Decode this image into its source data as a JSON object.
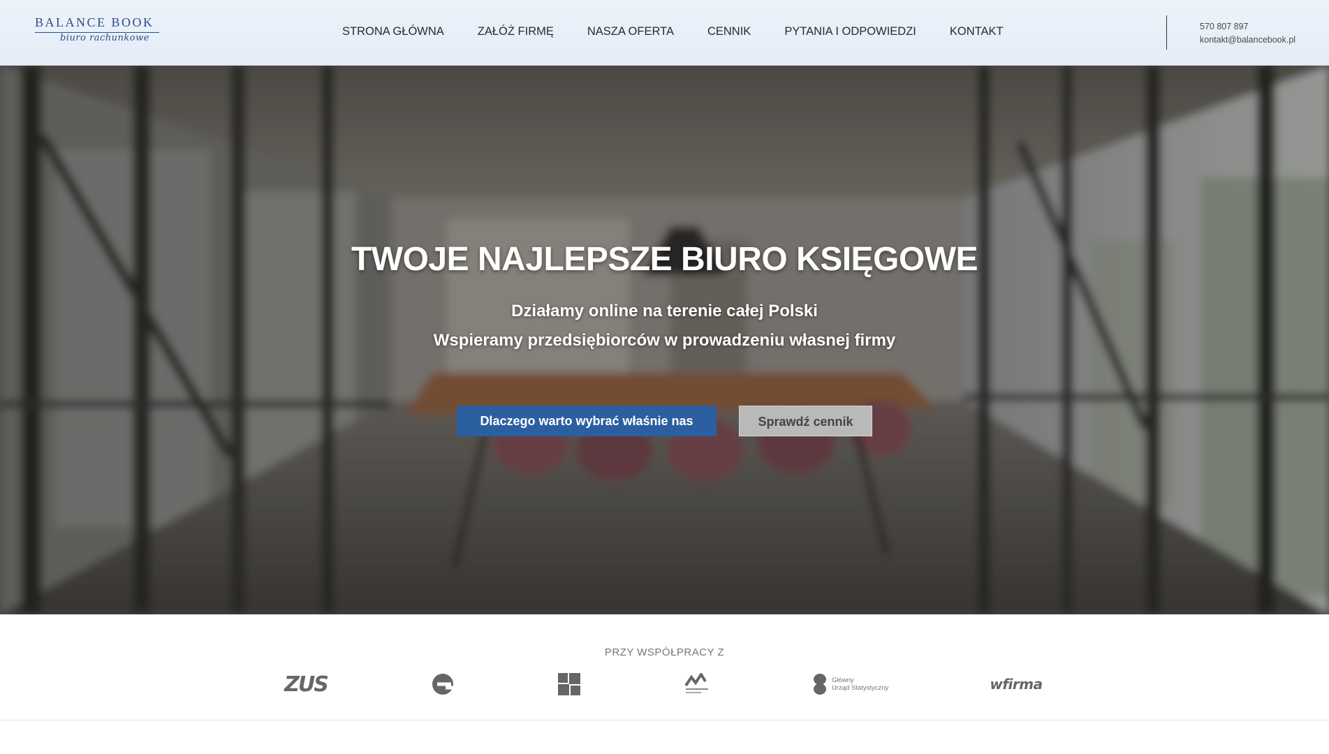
{
  "logo": {
    "main": "BALANCE BOOK",
    "sub": "biuro rachunkowe"
  },
  "nav": {
    "items": [
      {
        "label": "STRONA GŁÓWNA"
      },
      {
        "label": "ZAŁÓŻ FIRMĘ"
      },
      {
        "label": "NASZA OFERTA"
      },
      {
        "label": "CENNIK"
      },
      {
        "label": "PYTANIA I ODPOWIEDZI"
      },
      {
        "label": "KONTAKT"
      }
    ]
  },
  "contact": {
    "phone": "570 807 897",
    "email": "kontakt@balancebook.pl"
  },
  "hero": {
    "title": "TWOJE NAJLEPSZE BIURO KSIĘGOWE",
    "subtitle1": "Działamy online na terenie całej Polski",
    "subtitle2": "Wspieramy przedsiębiorców w prowadzeniu własnej firmy",
    "primary_button": "Dlaczego warto wybrać właśnie nas",
    "secondary_button": "Sprawdź cennik"
  },
  "partners": {
    "label": "PRZY WSPÓŁPRACY Z",
    "logos": [
      {
        "name": "zus-logo",
        "text": "ZUS"
      },
      {
        "name": "e-logo"
      },
      {
        "name": "squares-logo"
      },
      {
        "name": "ministerstwo-finansow-logo"
      },
      {
        "name": "gus-logo",
        "line1": "Główny",
        "line2": "Urząd Statystyczny"
      },
      {
        "name": "wfirma-logo",
        "text": "wfirma"
      }
    ]
  },
  "colors": {
    "brand": "#2b4f86",
    "primary_button": "#2b5fa0",
    "secondary_button": "#b9b9b9"
  }
}
